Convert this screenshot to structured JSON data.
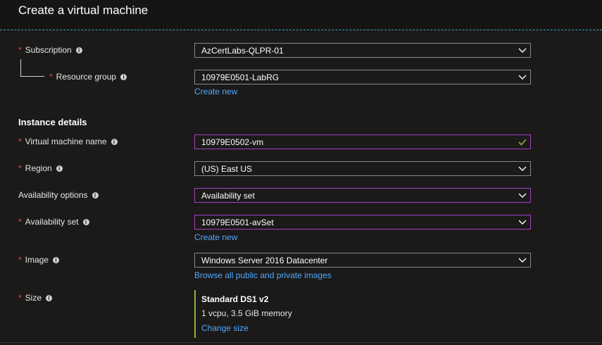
{
  "header": {
    "title": "Create a virtual machine"
  },
  "form": {
    "subscription": {
      "label": "Subscription",
      "value": "AzCertLabs-QLPR-01"
    },
    "resource_group": {
      "label": "Resource group",
      "value": "10979E0501-LabRG",
      "create_new": "Create new"
    },
    "instance_heading": "Instance details",
    "vm_name": {
      "label": "Virtual machine name",
      "value": "10979E0502-vm"
    },
    "region": {
      "label": "Region",
      "value": "(US) East US"
    },
    "availability_options": {
      "label": "Availability options",
      "value": "Availability set"
    },
    "availability_set": {
      "label": "Availability set",
      "value": "10979E0501-avSet",
      "create_new": "Create new"
    },
    "image": {
      "label": "Image",
      "value": "Windows Server 2016 Datacenter",
      "browse_link": "Browse all public and private images"
    },
    "size": {
      "label": "Size",
      "name": "Standard DS1 v2",
      "description": "1 vcpu, 3.5 GiB memory",
      "change_link": "Change size"
    }
  },
  "glyphs": {
    "required": "*",
    "info": "i"
  },
  "colors": {
    "required": "#e74c4c",
    "link": "#4ea8ff",
    "focus_border": "#a33fc2",
    "valid_check": "#8db53b"
  }
}
